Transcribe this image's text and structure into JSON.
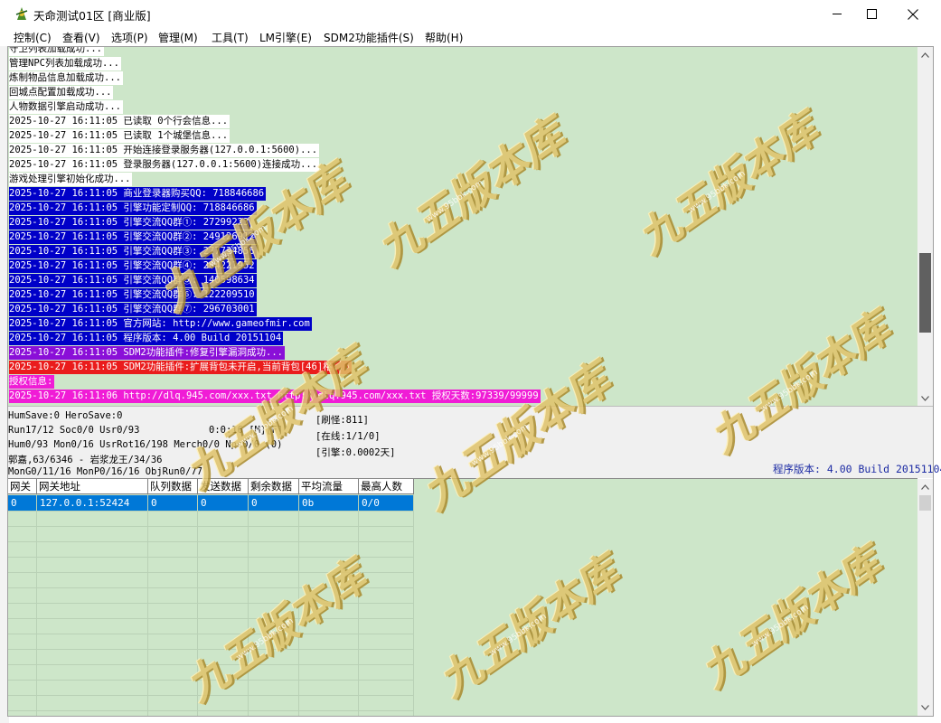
{
  "window": {
    "title": "天命测试01区 [商业版]",
    "minimize_icon": "minimize-icon",
    "maximize_icon": "maximize-icon",
    "close_icon": "close-icon"
  },
  "menu": [
    {
      "label": "控制(C)"
    },
    {
      "label": "查看(V)"
    },
    {
      "label": "选项(P)"
    },
    {
      "label": "管理(M)"
    },
    {
      "label": "工具(T)"
    },
    {
      "label": "LM引擎(E)"
    },
    {
      "label": "SDM2功能插件(S)"
    },
    {
      "label": "帮助(H)"
    }
  ],
  "log": {
    "lines": [
      {
        "text": "守卫列表加载成功...",
        "style": "white"
      },
      {
        "text": "管理NPC列表加载成功...",
        "style": "white"
      },
      {
        "text": "炼制物品信息加载成功...",
        "style": "white"
      },
      {
        "text": "回城点配置加载成功...",
        "style": "white"
      },
      {
        "text": "人物数据引擎启动成功...",
        "style": "white"
      },
      {
        "text": "2025-10-27 16:11:05 已读取 0个行会信息...",
        "style": "white"
      },
      {
        "text": "2025-10-27 16:11:05 已读取 1个城堡信息...",
        "style": "white"
      },
      {
        "text": "2025-10-27 16:11:05 开始连接登录服务器(127.0.0.1:5600)...",
        "style": "white"
      },
      {
        "text": "2025-10-27 16:11:05 登录服务器(127.0.0.1:5600)连接成功...",
        "style": "white"
      },
      {
        "text": "游戏处理引擎初始化成功...",
        "style": "white"
      },
      {
        "text": "2025-10-27 16:11:05 商业登录器购买QQ: 718846686",
        "style": "blue"
      },
      {
        "text": "2025-10-27 16:11:05 引擎功能定制QQ: 718846686",
        "style": "blue"
      },
      {
        "text": "2025-10-27 16:11:05 引擎交流QQ群①: 27299223",
        "style": "blue"
      },
      {
        "text": "2025-10-27 16:11:05 引擎交流QQ群②: 249126912",
        "style": "blue"
      },
      {
        "text": "2025-10-27 16:11:05 引擎交流QQ群③: 277734856",
        "style": "blue"
      },
      {
        "text": "2025-10-27 16:11:05 引擎交流QQ群④: 264221952",
        "style": "blue"
      },
      {
        "text": "2025-10-27 16:11:05 引擎交流QQ群⑤: 140598634",
        "style": "blue"
      },
      {
        "text": "2025-10-27 16:11:05 引擎交流QQ群⑥: 122209510",
        "style": "blue"
      },
      {
        "text": "2025-10-27 16:11:05 引擎交流QQ群⑦: 296703001",
        "style": "blue"
      },
      {
        "text": "2025-10-27 16:11:05 官方网站: http://www.gameofmir.com",
        "style": "blue"
      },
      {
        "text": "2025-10-27 16:11:05 程序版本: 4.00 Build 20151104",
        "style": "blue"
      },
      {
        "text": "2025-10-27 16:11:05 SDM2功能插件:修复引擎漏洞成功...",
        "style": "purple"
      },
      {
        "text": "2025-10-27 16:11:05 SDM2功能插件:扩展背包未开启,当前背包[46]格...",
        "style": "red"
      },
      {
        "text": "授权信息:",
        "style": "magenta"
      },
      {
        "text": "2025-10-27 16:11:06 http://dlq.945.com/xxx.txt http://dlq.945.com/xxx.txt 授权天数:97339/99999",
        "style": "magenta"
      }
    ]
  },
  "status": {
    "l1": "HumSave:0 HeroSave:0",
    "l2": "Run17/12 Soc0/0 Usr0/93",
    "l3": "Hum0/93 Mon0/16 UsrRot16/198 Merch0/0 Npc0/0 (0)",
    "l4": "郭嘉,63/6346 - 岩浆龙王/34/36",
    "l5": "MonG0/11/16 MonP0/16/16 ObjRun0/77",
    "timer": "0:0:16 [M][F]",
    "refresh": "[刷怪:811]",
    "online": "[在线:1/1/0]",
    "engine": "[引擎:0.0002天]",
    "version": "程序版本: 4.00 Build 20151104"
  },
  "gateway_table": {
    "headers": [
      "网关",
      "网关地址",
      "队列数据",
      "发送数据",
      "剩余数据",
      "平均流量",
      "最高人数"
    ],
    "rows": [
      [
        "0",
        "127.0.0.1:52424",
        "0",
        "0",
        "0",
        "0b",
        "0/0"
      ]
    ]
  },
  "watermark": {
    "text": "九五版本库",
    "url": "www.95bbk.com"
  },
  "colors": {
    "log_bg": "#cde6c9",
    "blue": "#0000c8",
    "purple": "#8a0fd8",
    "red": "#ea1c1c",
    "magenta": "#f01cd6",
    "selection": "#0078d7"
  }
}
